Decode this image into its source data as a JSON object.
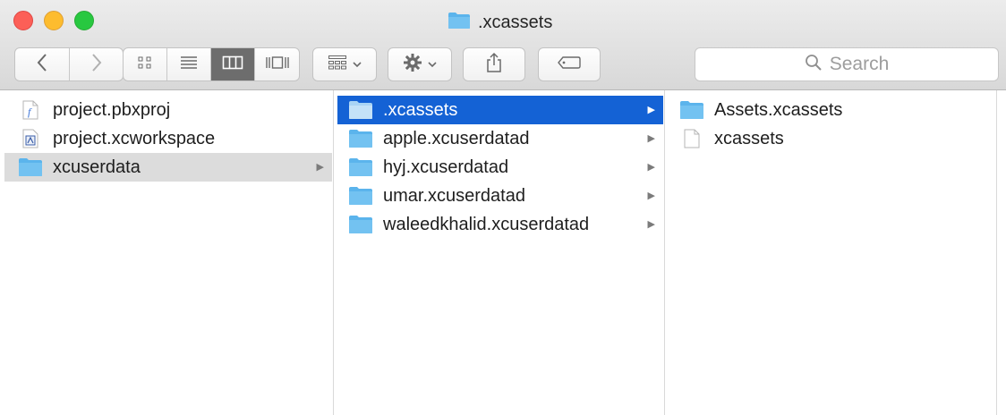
{
  "window": {
    "title": ".xcassets"
  },
  "toolbar": {
    "back_icon": "chevron-left-icon",
    "forward_icon": "chevron-right-icon",
    "view_modes": [
      "icon-view",
      "list-view",
      "column-view",
      "cover-flow-view"
    ],
    "active_view": "column-view",
    "arrange_icon": "arrange-grid-icon",
    "action_icon": "gear-icon",
    "share_icon": "share-icon",
    "tag_icon": "tag-icon",
    "search_placeholder": "Search"
  },
  "columns": [
    {
      "items": [
        {
          "name": "project.pbxproj",
          "icon": "pbxproj-file-icon",
          "has_children": false
        },
        {
          "name": "project.xcworkspace",
          "icon": "xcworkspace-file-icon",
          "has_children": false
        },
        {
          "name": "xcuserdata",
          "icon": "folder-icon",
          "has_children": true,
          "selected": "inactive"
        }
      ]
    },
    {
      "items": [
        {
          "name": ".xcassets",
          "icon": "folder-icon",
          "has_children": true,
          "selected": "active"
        },
        {
          "name": "apple.xcuserdatad",
          "icon": "folder-icon",
          "has_children": true
        },
        {
          "name": "hyj.xcuserdatad",
          "icon": "folder-icon",
          "has_children": true
        },
        {
          "name": "umar.xcuserdatad",
          "icon": "folder-icon",
          "has_children": true
        },
        {
          "name": "waleedkhalid.xcuserdatad",
          "icon": "folder-icon",
          "has_children": true
        }
      ]
    },
    {
      "items": [
        {
          "name": "Assets.xcassets",
          "icon": "folder-icon",
          "has_children": false
        },
        {
          "name": "xcassets",
          "icon": "document-icon",
          "has_children": false
        }
      ]
    }
  ],
  "colors": {
    "selection_active": "#1462d5",
    "selection_inactive": "#dcdcdc",
    "folder": "#5bb4ec"
  }
}
